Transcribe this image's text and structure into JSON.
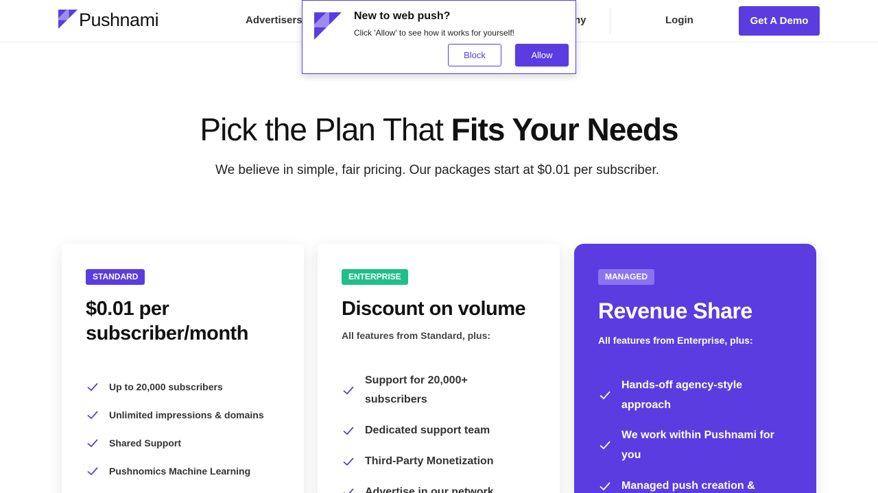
{
  "header": {
    "logo_text": "Pushnami",
    "nav": {
      "advertisers": "Advertisers",
      "company_partial": "ny",
      "login": "Login"
    },
    "cta": "Get A Demo"
  },
  "popup": {
    "title": "New to web push?",
    "text": "Click 'Allow' to see how it works for yourself!",
    "block": "Block",
    "allow": "Allow"
  },
  "hero": {
    "title_light": "Pick the Plan That",
    "title_bold": "Fits Your Needs",
    "subtitle": "We believe in simple, fair pricing. Our packages start at $0.01 per subscriber."
  },
  "plans": [
    {
      "badge": "STANDARD",
      "badge_color": "#5b3ce0",
      "title_line1": "$0.01 per",
      "title_line2": "subscriber/month",
      "features": [
        "Up to 20,000 subscribers",
        "Unlimited impressions & domains",
        "Shared Support",
        "Pushnomics Machine Learning"
      ]
    },
    {
      "badge": "ENTERPRISE",
      "badge_color": "#1fbf8a",
      "title": "Discount on volume",
      "note": "All features from Standard, plus:",
      "features": [
        {
          "line1": "Support for 20,000+",
          "line2": "subscribers"
        },
        "Dedicated support team",
        "Third-Party Monetization",
        "Advertise in our network"
      ]
    },
    {
      "badge": "MANAGED",
      "badge_color": "#8b72f0",
      "title": "Revenue Share",
      "note": "All features from Enterprise, plus:",
      "features": [
        {
          "line1": "Hands-off agency-style",
          "line2": "approach"
        },
        {
          "line1": "We work within Pushnami for",
          "line2": "you"
        },
        {
          "line1": "Managed push creation &",
          "line2": ""
        }
      ]
    }
  ],
  "colors": {
    "brand": "#5b3ce0",
    "enterprise": "#1fbf8a"
  }
}
